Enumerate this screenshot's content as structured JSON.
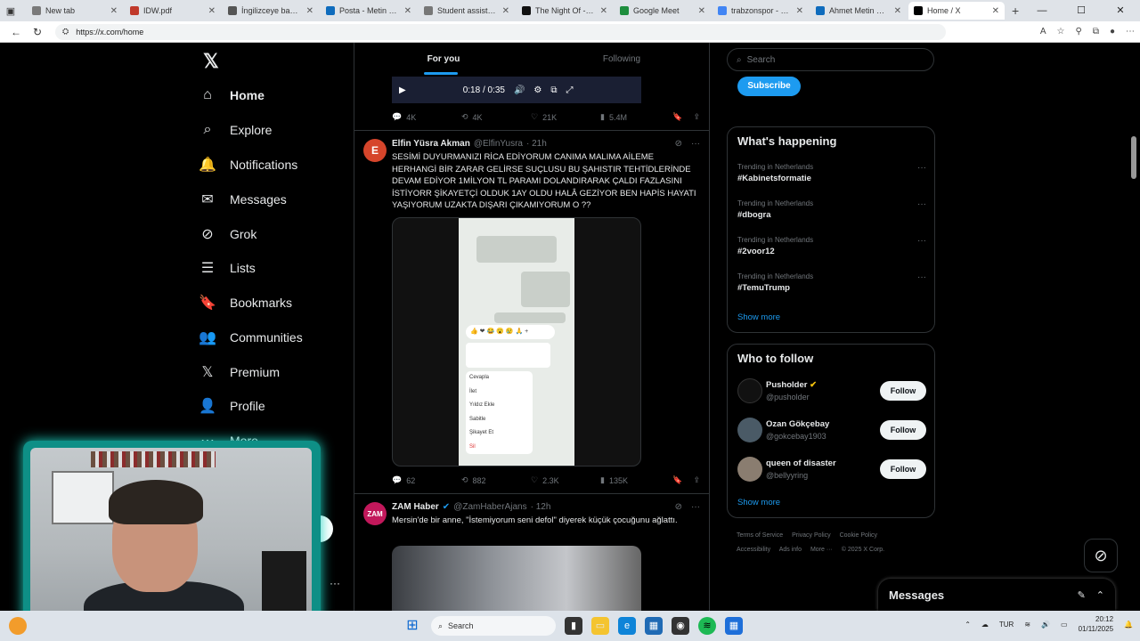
{
  "browser": {
    "tabs": [
      {
        "title": "New tab",
        "color": "#7a7a7a"
      },
      {
        "title": "IDW.pdf",
        "color": "#c0392b"
      },
      {
        "title": "İngilizceye başvuru",
        "color": "#555555"
      },
      {
        "title": "Posta - Metin Özde",
        "color": "#0f6cbd"
      },
      {
        "title": "Student assistent",
        "color": "#777777"
      },
      {
        "title": "The Night Of - HBO",
        "color": "#111111"
      },
      {
        "title": "Google Meet",
        "color": "#1e8e3e"
      },
      {
        "title": "trabzonspor - Goog",
        "color": "#4285f4"
      },
      {
        "title": "Ahmet Metin Özde",
        "color": "#0f6cbd"
      },
      {
        "title": "Home / X",
        "color": "#000000"
      }
    ],
    "url": "https://x.com/home"
  },
  "nav": {
    "items": [
      {
        "label": "Home",
        "icon": "home-icon",
        "glyph": "⌂"
      },
      {
        "label": "Explore",
        "icon": "search-icon",
        "glyph": "⌕"
      },
      {
        "label": "Notifications",
        "icon": "bell-icon",
        "glyph": "🔔"
      },
      {
        "label": "Messages",
        "icon": "envelope-icon",
        "glyph": "✉"
      },
      {
        "label": "Grok",
        "icon": "grok-icon",
        "glyph": "⊘"
      },
      {
        "label": "Lists",
        "icon": "list-icon",
        "glyph": "☰"
      },
      {
        "label": "Bookmarks",
        "icon": "bookmark-icon",
        "glyph": "🔖"
      },
      {
        "label": "Communities",
        "icon": "people-icon",
        "glyph": "👥"
      },
      {
        "label": "Premium",
        "icon": "x-logo-icon",
        "glyph": "𝕏"
      },
      {
        "label": "Profile",
        "icon": "person-icon",
        "glyph": "👤"
      },
      {
        "label": "More",
        "icon": "more-circle-icon",
        "glyph": "⋯"
      }
    ]
  },
  "feed": {
    "tabs": [
      "For you",
      "Following"
    ],
    "video": {
      "time": "0:18 / 0:35"
    },
    "first_stats": {
      "replies": "4K",
      "reposts": "4K",
      "likes": "21K",
      "views": "5.4M"
    },
    "tweets": [
      {
        "avatar_letter": "E",
        "avatar_color": "#d6452b",
        "name": "Elfin Yüsra Akman",
        "handle": "@ElfinYusra",
        "time": "· 21h",
        "text": "SESİMİ DUYURMANIZI RİCA EDİYORUM CANIMA MALIMA AİLEME HERHANGİ BİR ZARAR GELİRSE SUÇLUSU BU ŞAHISTIR TEHTİDLERİNDE DEVAM EDİYOR 1MİLYON TL PARAMI DOLANDIRARAK ÇALDI FAZLASINI İSTİYORR ŞİKAYETÇİ OLDUK 1AY OLDU HALÂ GEZİYOR BEN HAPİS HAYATI YAŞIYORUM UZAKTA DIŞARI ÇIKAMIYORUM O ??",
        "stats": {
          "replies": "62",
          "reposts": "882",
          "likes": "2.3K",
          "views": "135K"
        },
        "menu": [
          "Cevapla",
          "İlet",
          "Yıldız Ekle",
          "Sabitle",
          "Şikayet Et",
          "Sil"
        ]
      },
      {
        "avatar_letter": "ZAM",
        "avatar_color": "#c2185b",
        "name": "ZAM Haber",
        "handle": "@ZamHaberAjans",
        "time": "· 12h",
        "text": "Mersin'de bir anne, \"İstemiyorum seni defol\" diyerek küçük çocuğunu ağlattı."
      }
    ]
  },
  "right": {
    "search_placeholder": "Search",
    "subscribe": "Subscribe",
    "happening_title": "What's happening",
    "trends": [
      {
        "context": "Trending in Netherlands",
        "tag": "#Kabinetsformatie"
      },
      {
        "context": "Trending in Netherlands",
        "tag": "#dbogra"
      },
      {
        "context": "Trending in Netherlands",
        "tag": "#2voor12"
      },
      {
        "context": "Trending in Netherlands",
        "tag": "#TemuTrump"
      }
    ],
    "show_more": "Show more",
    "wtf_title": "Who to follow",
    "who_to_follow": [
      {
        "name": "Pusholder",
        "handle": "@pusholder",
        "color": "#111111"
      },
      {
        "name": "Ozan Gökçebay",
        "handle": "@gokcebay1903",
        "color": "#4a5a66"
      },
      {
        "name": "queen of disaster",
        "handle": "@bellyyring",
        "color": "#8a7d70"
      }
    ],
    "follow_label": "Follow",
    "footer": [
      "Terms of Service",
      "Privacy Policy",
      "Cookie Policy",
      "Accessibility",
      "Ads info",
      "More ···",
      "© 2025 X Corp."
    ]
  },
  "messages_drawer": {
    "title": "Messages"
  },
  "taskbar": {
    "search": "Search",
    "lang": "TUR",
    "time": "20:12",
    "date": "01/11/2025"
  },
  "colors": {
    "accent": "#1d9bf0",
    "background": "#000000",
    "border": "#2f3336"
  }
}
